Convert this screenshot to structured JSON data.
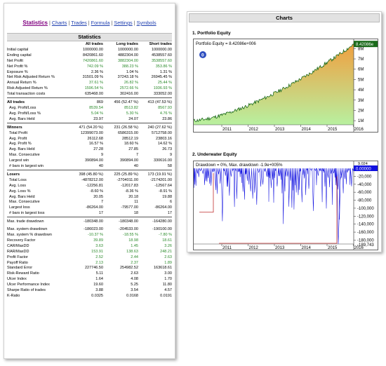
{
  "nav": {
    "items": [
      {
        "label": "Statistics",
        "active": true
      },
      {
        "label": "Charts",
        "active": false
      },
      {
        "label": "Trades",
        "active": false
      },
      {
        "label": "Formula",
        "active": false
      },
      {
        "label": "Settings",
        "active": false
      },
      {
        "label": "Symbols",
        "active": false
      }
    ],
    "separator": "|"
  },
  "stats": {
    "title": "Statistics",
    "columns": [
      "",
      "All trades",
      "Long trades",
      "Short trades"
    ],
    "rows": [
      {
        "label": "Initial capital",
        "v": [
          "1000000.00",
          "1000000.00",
          "1000000.00"
        ]
      },
      {
        "label": "Ending capital",
        "v": [
          "8420861.60",
          "4882304.00",
          "4538557.60"
        ]
      },
      {
        "label": "Net Profit",
        "v": [
          "7420861.60",
          "3882304.00",
          "3538557.60"
        ],
        "green": true
      },
      {
        "label": "Net Profit %",
        "v": [
          "742.09 %",
          "388.23 %",
          "353.86 %"
        ],
        "green": true
      },
      {
        "label": "Exposure %",
        "v": [
          "2.36 %",
          "1.04 %",
          "1.31 %"
        ]
      },
      {
        "label": "Net Risk Adjusted Return %",
        "v": [
          "31501.09 %",
          "37243.18 %",
          "26945.45 %"
        ]
      },
      {
        "label": "Annual Return %",
        "v": [
          "37.61 %",
          "26.82 %",
          "25.44 %"
        ],
        "green": true
      },
      {
        "label": "Risk Adjusted Return %",
        "v": [
          "1596.54 %",
          "2572.66 %",
          "1936.93 %"
        ],
        "green": true
      },
      {
        "label": "Total transaction costs",
        "v": [
          "635468.00",
          "302416.00",
          "333052.00"
        ]
      },
      {
        "div": true
      },
      {
        "label": "All trades",
        "v": [
          "869",
          "456 (52.47 %)",
          "413 (47.53 %)"
        ],
        "section": true
      },
      {
        "label": "Avg. Profit/Loss",
        "v": [
          "8539.54",
          "8513.82",
          "8567.93"
        ],
        "indent": true,
        "green": true
      },
      {
        "label": "Avg. Profit/Loss %",
        "v": [
          "5.04 %",
          "5.30 %",
          "4.76 %"
        ],
        "indent": true,
        "green": true
      },
      {
        "label": "Avg. Bars Held",
        "v": [
          "23.97",
          "24.07",
          "23.86"
        ],
        "indent": true
      },
      {
        "div": true
      },
      {
        "label": "Winners",
        "v": [
          "471 (54.20 %)",
          "231 (26.58 %)",
          "240 (27.62 %)"
        ],
        "section": true
      },
      {
        "label": "Total Profit",
        "v": [
          "12399073.00",
          "6586315.00",
          "5712758.00"
        ],
        "indent": true
      },
      {
        "label": "Avg. Profit",
        "v": [
          "26112.68",
          "28512.19",
          "23803.16"
        ],
        "indent": true
      },
      {
        "label": "Avg. Profit %",
        "v": [
          "16.57 %",
          "18.60 %",
          "14.62 %"
        ],
        "indent": true
      },
      {
        "label": "Avg. Bars Held",
        "v": [
          "27.28",
          "27.85",
          "26.73"
        ],
        "indent": true
      },
      {
        "label": "Max. Consecutive",
        "v": [
          "9",
          "7",
          "9"
        ],
        "indent": true
      },
      {
        "label": "Largest win",
        "v": [
          "390894.00",
          "390894.00",
          "330616.00"
        ],
        "indent": true
      },
      {
        "label": "# bars in largest win",
        "v": [
          "40",
          "40",
          "58"
        ],
        "indent": true
      },
      {
        "div": true
      },
      {
        "label": "Losers",
        "v": [
          "398 (45.80 %)",
          "225 (25.89 %)",
          "173 (19.91 %)"
        ],
        "section": true
      },
      {
        "label": "Total Loss",
        "v": [
          "-4878212.00",
          "-2704011.00",
          "-2174201.00"
        ],
        "indent": true
      },
      {
        "label": "Avg. Loss",
        "v": [
          "-12256.81",
          "-12017.83",
          "-12567.64"
        ],
        "indent": true
      },
      {
        "label": "Avg. Loss %",
        "v": [
          "-8.60 %",
          "-8.36 %",
          "-8.91 %"
        ],
        "indent": true
      },
      {
        "label": "Avg. Bars Held",
        "v": [
          "20.05",
          "20.18",
          "19.88"
        ],
        "indent": true
      },
      {
        "label": "Max. Consecutive",
        "v": [
          "7",
          "11",
          "6"
        ],
        "indent": true
      },
      {
        "label": "Largest loss",
        "v": [
          "-86264.00",
          "-79577.00",
          "-86264.00"
        ],
        "indent": true
      },
      {
        "label": "# bars in largest loss",
        "v": [
          "17",
          "18",
          "17"
        ],
        "indent": true
      },
      {
        "div": true
      },
      {
        "label": "Max. trade drawdown",
        "v": [
          "-180348.00",
          "-180348.00",
          "-164280.00"
        ]
      },
      {
        "sp": true
      },
      {
        "label": "Max. system drawdown",
        "v": [
          "-186023.00",
          "-204533.00",
          "-190100.00"
        ]
      },
      {
        "label": "Max. system % drawdown",
        "v": [
          "-10.37 %",
          "-18.55 %",
          "-7.80 %"
        ],
        "green": true
      },
      {
        "label": "Recovery Factor",
        "v": [
          "39.89",
          "18.98",
          "18.61"
        ],
        "green": true
      },
      {
        "label": "CAR/MaxDD",
        "v": [
          "3.63",
          "1.45",
          "3.26"
        ],
        "green": true
      },
      {
        "label": "RAR/MaxDD",
        "v": [
          "153.91",
          "138.63",
          "248.21"
        ],
        "green": true
      },
      {
        "label": "Profit Factor",
        "v": [
          "2.52",
          "2.44",
          "2.63"
        ],
        "green": true
      },
      {
        "label": "Payoff Ratio",
        "v": [
          "2.13",
          "2.37",
          "1.89"
        ],
        "green": true
      },
      {
        "label": "Standard Error",
        "v": [
          "227746.50",
          "254982.52",
          "163618.61"
        ]
      },
      {
        "label": "Risk-Reward Ratio",
        "v": [
          "5.11",
          "2.63",
          "3.00"
        ]
      },
      {
        "label": "Ulcer Index",
        "v": [
          "1.64",
          "4.08",
          "1.70"
        ]
      },
      {
        "label": "Ulcer Performance Index",
        "v": [
          "19.60",
          "5.25",
          "11.80"
        ]
      },
      {
        "label": "Sharpe Ratio of trades",
        "v": [
          "3.88",
          "3.54",
          "4.57"
        ]
      },
      {
        "label": "K-Ratio",
        "v": [
          "0.0325",
          "0.0168",
          "0.0191"
        ]
      }
    ]
  },
  "charts": {
    "header": "Charts",
    "equity": {
      "title": "1. Portfolio Equity",
      "legend": "Portfolio Equity = 8.42086e+006",
      "last_value": "8.42086e",
      "badge": "0",
      "y_ticks": [
        "8M",
        "7M",
        "6M",
        "5M",
        "4M",
        "3M",
        "2M",
        "1M"
      ],
      "x_ticks": [
        "2011",
        "2012",
        "2013",
        "2014",
        "2015",
        "2016"
      ],
      "colors": {
        "top": "#f0a040",
        "bottom": "#b8f0a0",
        "line": "#1a6a1a",
        "badge": "#3050c0"
      }
    },
    "underwater": {
      "title": "2. Underwater Equity",
      "legend": "Drawdown = 0%, Max. drawdown -1.9e+005%",
      "last_value": "0.00000",
      "top_value": "9.024",
      "bottom_value": "-189,743",
      "y_ticks": [
        "-20,000",
        "-40,000",
        "-60,000",
        "-80,000",
        "-100,000",
        "-120,000",
        "-140,000",
        "-160,000",
        "-180,000"
      ],
      "x_ticks": [
        "2011",
        "2012",
        "2013",
        "2014",
        "2015",
        "2016"
      ],
      "colors": {
        "line": "#1010e0",
        "max_line": "#c03030",
        "label_bg": "#1010e0"
      }
    }
  }
}
